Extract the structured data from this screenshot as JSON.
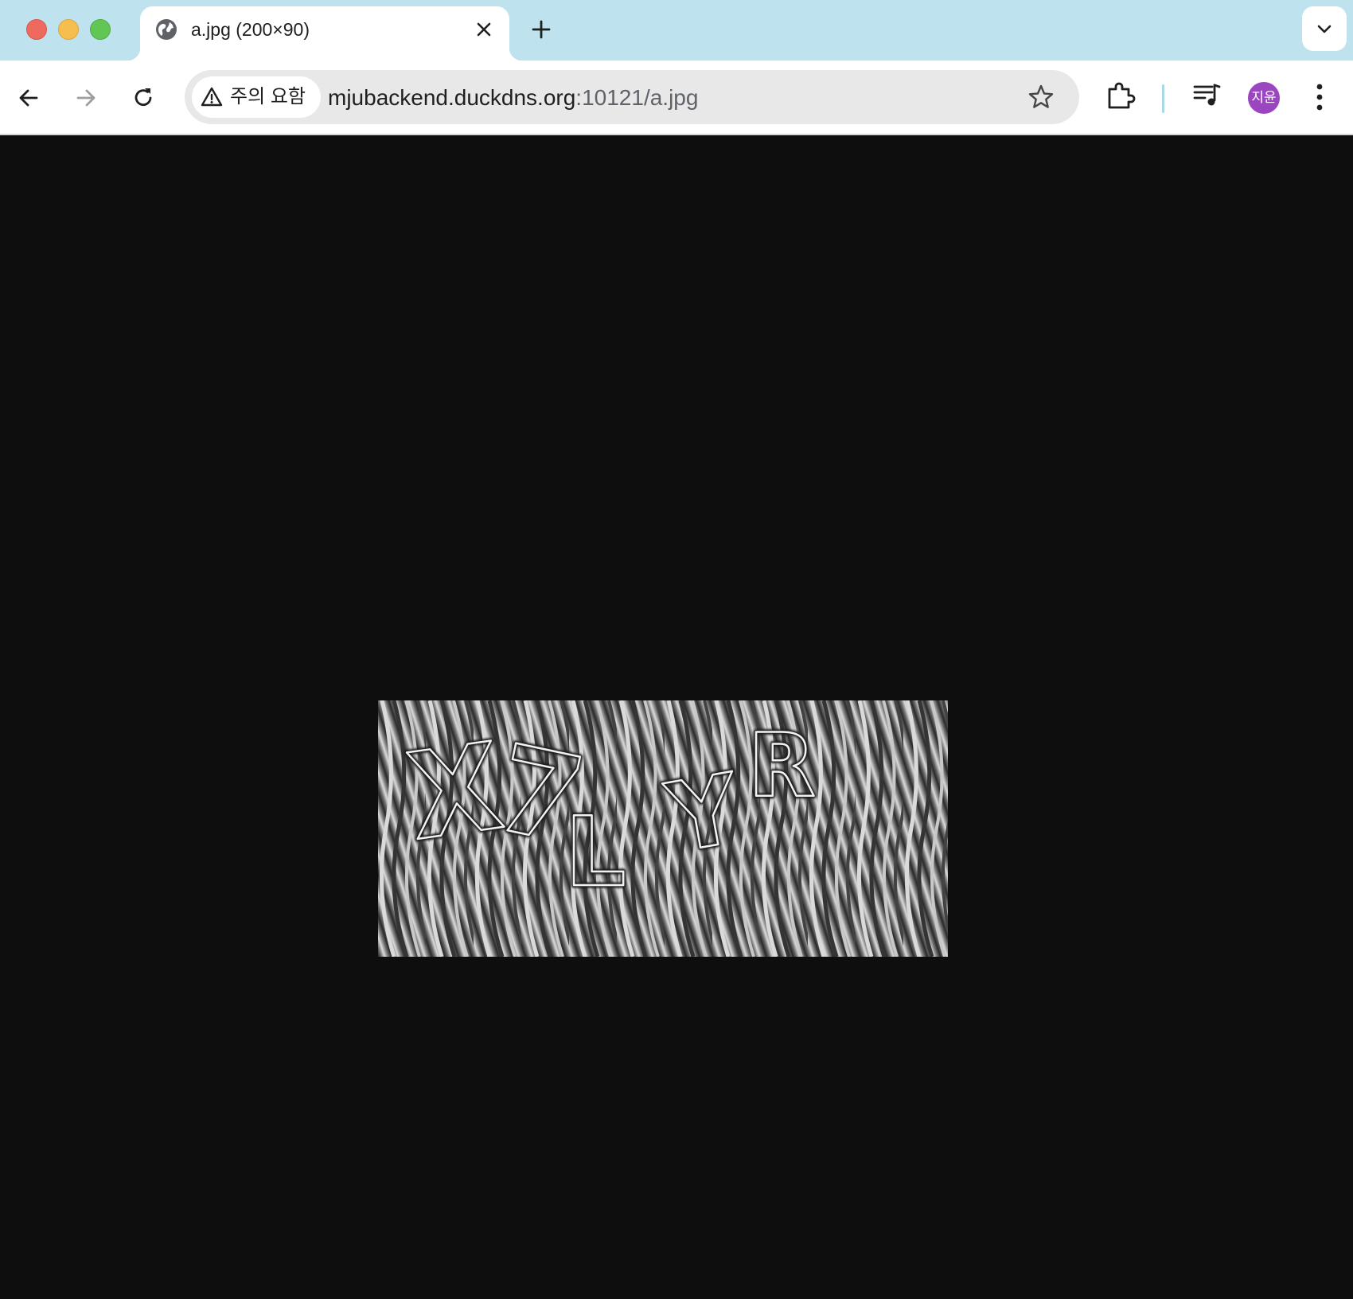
{
  "window": {
    "controls": [
      "close",
      "minimize",
      "maximize"
    ]
  },
  "tab": {
    "title": "a.jpg (200×90)",
    "favicon": "globe-icon"
  },
  "toolbar": {
    "security_chip_label": "주의 요함",
    "url_host": "mjubackend.duckdns.org",
    "url_rest": ":10121/a.jpg",
    "profile_initials": "지윤"
  },
  "content": {
    "image_description_alt": "a.jpg",
    "captcha_glyphs": [
      "X",
      "7",
      "L",
      "Y",
      "R"
    ]
  },
  "colors": {
    "tabstrip_bg": "#bfe3ee",
    "content_bg": "#0e0e0e",
    "avatar_bg": "#9b46c0"
  }
}
